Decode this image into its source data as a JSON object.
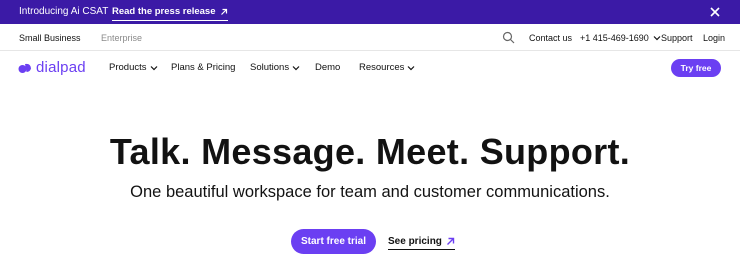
{
  "banner": {
    "text": "Introducing Ai CSAT",
    "link_label": "Read the press release",
    "link_icon": "arrow-up-right-icon",
    "close_icon": "close-icon"
  },
  "utility": {
    "small_business": "Small Business",
    "enterprise": "Enterprise",
    "search_icon": "search-icon",
    "contact": "Contact us",
    "phone": "+1 415-469-1690",
    "support": "Support",
    "login": "Login"
  },
  "nav": {
    "logo": "dialpad",
    "items": [
      "Products",
      "Plans & Pricing",
      "Solutions",
      "Demo",
      "Resources"
    ],
    "try_label": "Try free"
  },
  "hero": {
    "title": "Talk. Message. Meet. Support.",
    "subtitle": "One beautiful workspace for team and customer communications.",
    "primary_cta": "Start free trial",
    "secondary_cta": "See pricing"
  },
  "colors": {
    "banner_bg": "#3b1aa6",
    "brand_purple": "#6b3ff2",
    "text": "#121212",
    "muted": "#8a8a8a"
  }
}
